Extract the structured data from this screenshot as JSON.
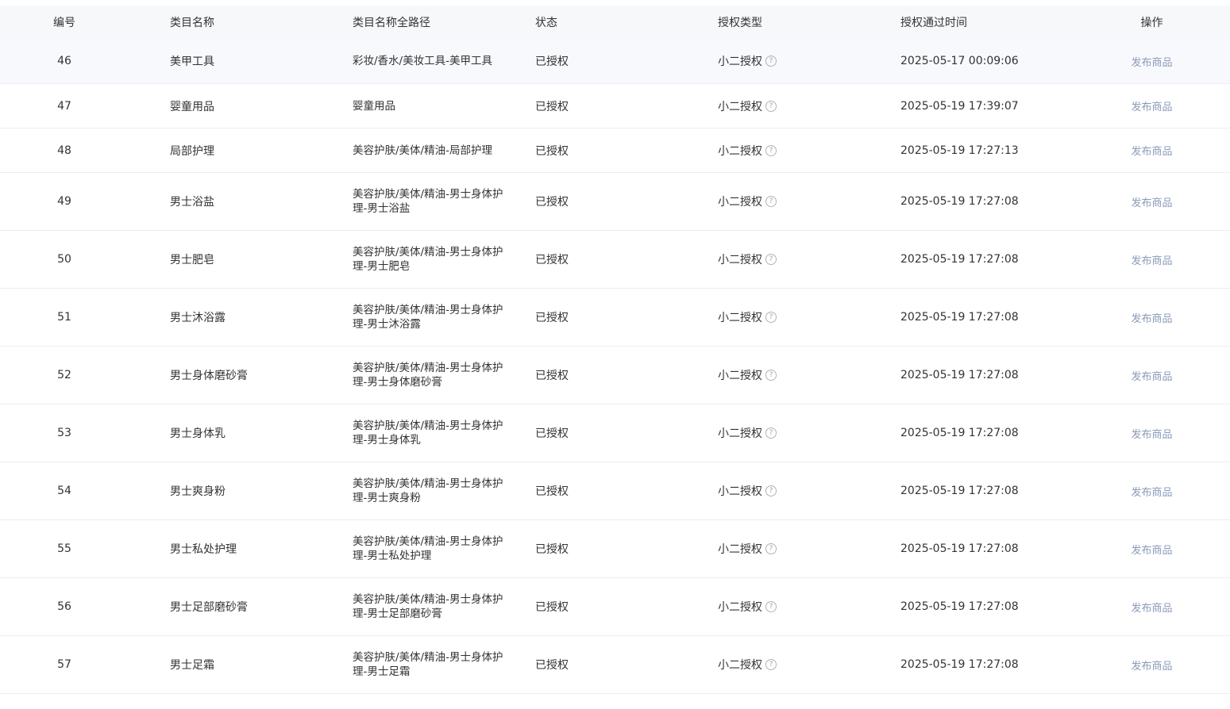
{
  "table": {
    "headers": {
      "id": "编号",
      "name": "类目名称",
      "path": "类目名称全路径",
      "status": "状态",
      "auth_type": "授权类型",
      "auth_time": "授权通过时间",
      "action": "操作"
    },
    "rows": [
      {
        "id": "46",
        "name": "美甲工具",
        "path": "彩妆/香水/美妆工具-美甲工具",
        "status": "已授权",
        "auth_type": "小二授权",
        "auth_time": "2025-05-17 00:09:06",
        "action": "发布商品"
      },
      {
        "id": "47",
        "name": "婴童用品",
        "path": "婴童用品",
        "status": "已授权",
        "auth_type": "小二授权",
        "auth_time": "2025-05-19 17:39:07",
        "action": "发布商品"
      },
      {
        "id": "48",
        "name": "局部护理",
        "path": "美容护肤/美体/精油-局部护理",
        "status": "已授权",
        "auth_type": "小二授权",
        "auth_time": "2025-05-19 17:27:13",
        "action": "发布商品"
      },
      {
        "id": "49",
        "name": "男士浴盐",
        "path": "美容护肤/美体/精油-男士身体护理-男士浴盐",
        "status": "已授权",
        "auth_type": "小二授权",
        "auth_time": "2025-05-19 17:27:08",
        "action": "发布商品"
      },
      {
        "id": "50",
        "name": "男士肥皂",
        "path": "美容护肤/美体/精油-男士身体护理-男士肥皂",
        "status": "已授权",
        "auth_type": "小二授权",
        "auth_time": "2025-05-19 17:27:08",
        "action": "发布商品"
      },
      {
        "id": "51",
        "name": "男士沐浴露",
        "path": "美容护肤/美体/精油-男士身体护理-男士沐浴露",
        "status": "已授权",
        "auth_type": "小二授权",
        "auth_time": "2025-05-19 17:27:08",
        "action": "发布商品"
      },
      {
        "id": "52",
        "name": "男士身体磨砂膏",
        "path": "美容护肤/美体/精油-男士身体护理-男士身体磨砂膏",
        "status": "已授权",
        "auth_type": "小二授权",
        "auth_time": "2025-05-19 17:27:08",
        "action": "发布商品"
      },
      {
        "id": "53",
        "name": "男士身体乳",
        "path": "美容护肤/美体/精油-男士身体护理-男士身体乳",
        "status": "已授权",
        "auth_type": "小二授权",
        "auth_time": "2025-05-19 17:27:08",
        "action": "发布商品"
      },
      {
        "id": "54",
        "name": "男士爽身粉",
        "path": "美容护肤/美体/精油-男士身体护理-男士爽身粉",
        "status": "已授权",
        "auth_type": "小二授权",
        "auth_time": "2025-05-19 17:27:08",
        "action": "发布商品"
      },
      {
        "id": "55",
        "name": "男士私处护理",
        "path": "美容护肤/美体/精油-男士身体护理-男士私处护理",
        "status": "已授权",
        "auth_type": "小二授权",
        "auth_time": "2025-05-19 17:27:08",
        "action": "发布商品"
      },
      {
        "id": "56",
        "name": "男士足部磨砂膏",
        "path": "美容护肤/美体/精油-男士身体护理-男士足部磨砂膏",
        "status": "已授权",
        "auth_type": "小二授权",
        "auth_time": "2025-05-19 17:27:08",
        "action": "发布商品"
      },
      {
        "id": "57",
        "name": "男士足霜",
        "path": "美容护肤/美体/精油-男士身体护理-男士足霜",
        "status": "已授权",
        "auth_type": "小二授权",
        "auth_time": "2025-05-19 17:27:08",
        "action": "发布商品"
      }
    ]
  },
  "colors": {
    "header_bg": "#f7f8fa",
    "row_highlight_bg": "#f7f9fc",
    "link": "#8a9bb8",
    "border": "#ebedf0"
  },
  "icons": {
    "help": "question-circle-icon"
  }
}
